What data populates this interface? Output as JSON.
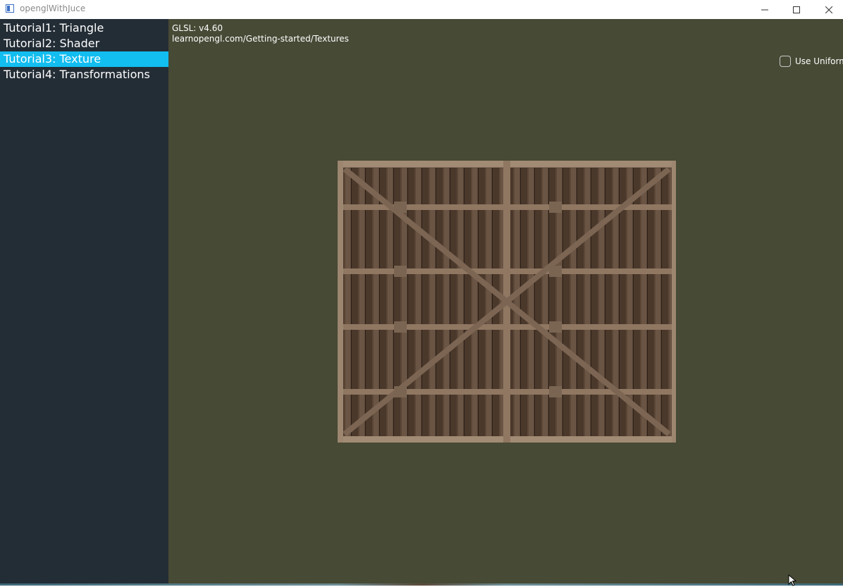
{
  "window": {
    "title": "openglWithJuce"
  },
  "sidebar": {
    "items": [
      {
        "label": "Tutorial1: Triangle",
        "selected": false
      },
      {
        "label": "Tutorial2: Shader",
        "selected": false
      },
      {
        "label": "Tutorial3: Texture",
        "selected": true
      },
      {
        "label": "Tutorial4: Transformations",
        "selected": false
      }
    ]
  },
  "main": {
    "glsl_version": "GLSL: v4.60",
    "url": "learnopengl.com/Getting-started/Textures",
    "uniform_checkbox": {
      "label": "Use Uniform",
      "checked": false
    }
  },
  "colors": {
    "sidebar_bg": "#232d36",
    "selected_bg": "#12bdf0",
    "canvas_bg": "#474a35"
  },
  "icons": {
    "app": "app-icon",
    "minimize": "minimize-icon",
    "maximize": "maximize-icon",
    "close": "close-icon"
  }
}
